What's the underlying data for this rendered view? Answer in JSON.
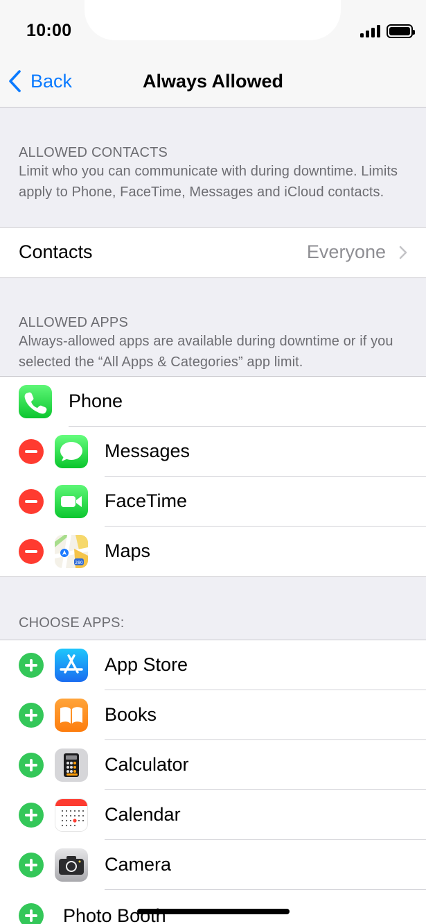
{
  "status": {
    "time": "10:00"
  },
  "nav": {
    "back_label": "Back",
    "title": "Always Allowed"
  },
  "contacts_section": {
    "header": "ALLOWED CONTACTS",
    "description": "Limit who you can communicate with during downtime. Limits apply to Phone, FaceTime, Messages and iCloud contacts.",
    "row_label": "Contacts",
    "row_value": "Everyone"
  },
  "allowed_apps_section": {
    "header": "ALLOWED APPS",
    "description": "Always-allowed apps are available during downtime or if you selected the “All Apps & Categories” app limit.",
    "apps": [
      {
        "label": "Phone",
        "icon": "phone-icon"
      },
      {
        "label": "Messages",
        "icon": "messages-icon"
      },
      {
        "label": "FaceTime",
        "icon": "facetime-icon"
      },
      {
        "label": "Maps",
        "icon": "maps-icon"
      }
    ]
  },
  "choose_apps_section": {
    "header": "CHOOSE APPS:",
    "apps": [
      {
        "label": "App Store",
        "icon": "app-store-icon"
      },
      {
        "label": "Books",
        "icon": "books-icon"
      },
      {
        "label": "Calculator",
        "icon": "calculator-icon"
      },
      {
        "label": "Calendar",
        "icon": "calendar-icon"
      },
      {
        "label": "Camera",
        "icon": "camera-icon"
      },
      {
        "label": "Photo Booth",
        "icon": "photo-booth-icon"
      }
    ]
  },
  "colors": {
    "accent": "#0a7aff",
    "remove": "#ff3b30",
    "add": "#34c759",
    "secondary_text": "#6d6d72",
    "background": "#efeff4"
  }
}
